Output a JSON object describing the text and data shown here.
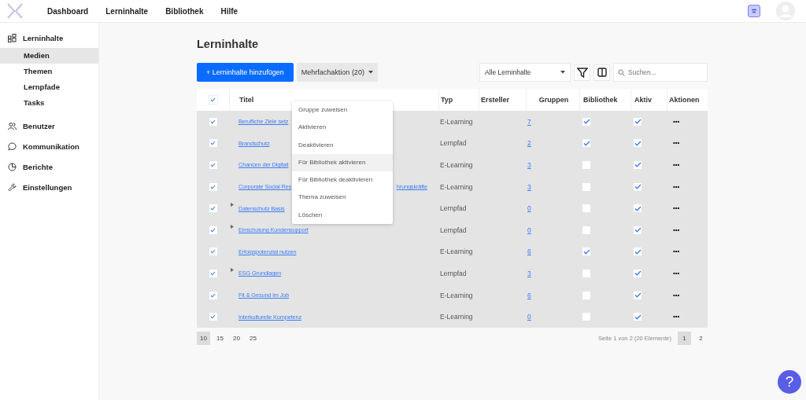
{
  "topnav": [
    {
      "label": "Dashboard"
    },
    {
      "label": "Lerninhalte"
    },
    {
      "label": "Bibliothek"
    },
    {
      "label": "Hilfe"
    }
  ],
  "sidebar": {
    "items": [
      {
        "label": "Lerninhalte",
        "children": [
          {
            "label": "Medien",
            "selected": true
          },
          {
            "label": "Themen",
            "selected": false
          },
          {
            "label": "Lernpfade",
            "selected": false
          },
          {
            "label": "Tasks",
            "selected": false
          }
        ]
      },
      {
        "label": "Benutzer"
      },
      {
        "label": "Kommunikation"
      },
      {
        "label": "Berichte"
      },
      {
        "label": "Einstellungen"
      }
    ]
  },
  "page_title": "Lerninhalte",
  "toolbar": {
    "add_button": "+ Lerninhalte hinzufügen",
    "bulk_button": "Mehrfachaktion (20)",
    "filter_select": "Alle Lerninhalte",
    "search": {
      "placeholder": "Suchen..."
    }
  },
  "bulk_menu": [
    {
      "label": "Gruppe zuweisen",
      "selected": false
    },
    {
      "label": "Aktivieren",
      "selected": false
    },
    {
      "label": "Deaktivieren",
      "selected": false
    },
    {
      "label": "Für Bibliothek aktivieren",
      "selected": true
    },
    {
      "label": "Für Bibliothek deaktivieren",
      "selected": false
    },
    {
      "label": "Thema zuweisen",
      "selected": false
    },
    {
      "label": "Löschen",
      "selected": false
    }
  ],
  "table": {
    "all_checked": true,
    "columns": [
      "Titel",
      "Typ",
      "Ersteller",
      "Gruppen",
      "Bibliothek",
      "Aktiv",
      "Aktionen"
    ],
    "rows": [
      {
        "selected": true,
        "expandable": false,
        "title": "Berufliche Ziele setz",
        "type": "E-Learning",
        "groups": "7",
        "library": true,
        "active": true,
        "actions": "•••"
      },
      {
        "selected": true,
        "expandable": false,
        "title": "Brandschutz",
        "type": "Lernpfad",
        "groups": "2",
        "library": true,
        "active": true,
        "actions": "•••"
      },
      {
        "selected": true,
        "expandable": false,
        "title": "Chancen der Digitali",
        "type": "E-Learning",
        "groups": "3",
        "library": false,
        "active": true,
        "actions": "•••"
      },
      {
        "selected": true,
        "expandable": false,
        "title": "Corporate Social Res",
        "title_end": "hrungskräfte",
        "type": "E-Learning",
        "groups": "3",
        "library": false,
        "active": true,
        "actions": "•••"
      },
      {
        "selected": true,
        "expandable": true,
        "title": "Datenschutz Basis",
        "type": "Lernpfad",
        "groups": "0",
        "library": false,
        "active": true,
        "actions": "•••"
      },
      {
        "selected": true,
        "expandable": true,
        "title": "Einschulung Kundensupport",
        "type": "Lernpfad",
        "groups": "0",
        "library": false,
        "active": true,
        "actions": "•••"
      },
      {
        "selected": true,
        "expandable": false,
        "title": "Erfolgspotenzial nutzen",
        "type": "E-Learning",
        "groups": "6",
        "library": true,
        "active": true,
        "actions": "•••"
      },
      {
        "selected": true,
        "expandable": true,
        "title": "ESG Grundlagen",
        "type": "Lernpfad",
        "groups": "3",
        "library": false,
        "active": true,
        "actions": "•••"
      },
      {
        "selected": true,
        "expandable": false,
        "title": "Fit & Gesund im Job",
        "type": "E-Learning",
        "groups": "6",
        "library": false,
        "active": true,
        "actions": "•••"
      },
      {
        "selected": true,
        "expandable": false,
        "title": "Interkulturelle Kompetenz",
        "type": "E-Learning",
        "groups": "0",
        "library": false,
        "active": true,
        "actions": "•••"
      }
    ]
  },
  "page_sizes": [
    {
      "label": "10",
      "selected": true
    },
    {
      "label": "15",
      "selected": false
    },
    {
      "label": "20",
      "selected": false
    },
    {
      "label": "25",
      "selected": false
    }
  ],
  "page_info": "Seite 1 von 2 (20 Elemente)",
  "pages": [
    {
      "label": "1",
      "selected": true
    },
    {
      "label": "2",
      "selected": false
    }
  ],
  "help_button": "?"
}
